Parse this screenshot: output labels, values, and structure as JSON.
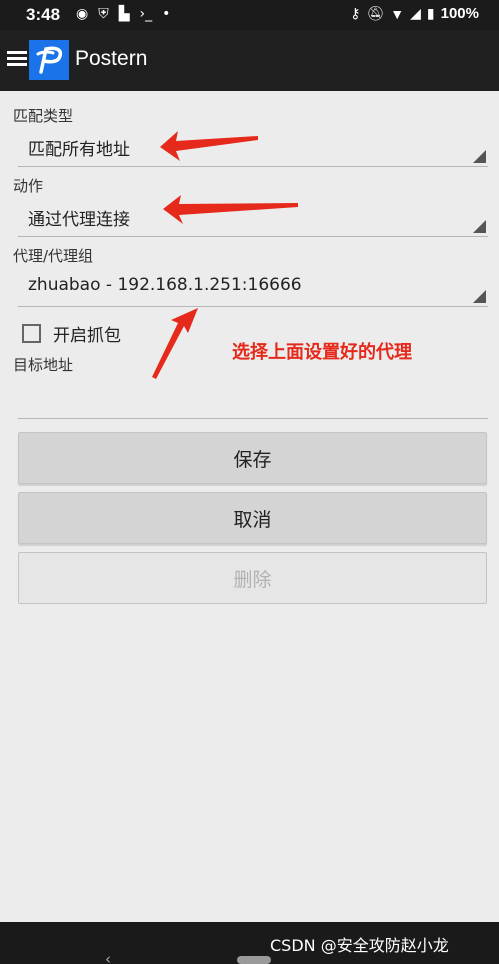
{
  "status_bar": {
    "time": "3:48",
    "left_icons": [
      "media-icon",
      "shield-icon",
      "android-icon",
      "terminal-icon",
      "dot-icon"
    ],
    "battery": "100%"
  },
  "app_bar": {
    "title": "Postern"
  },
  "form": {
    "match_type_label": "匹配类型",
    "match_type_value": "匹配所有地址",
    "action_label": "动作",
    "action_value": "通过代理连接",
    "proxy_label": "代理/代理组",
    "proxy_value": "zhuabao - 192.168.1.251:16666",
    "capture_label": "开启抓包",
    "capture_checked": false,
    "target_label": "目标地址",
    "target_value": ""
  },
  "buttons": {
    "save": "保存",
    "cancel": "取消",
    "delete": "删除"
  },
  "annotation": {
    "text": "选择上面设置好的代理",
    "color": "#e52a1c"
  },
  "footer": {
    "watermark": "CSDN @安全攻防赵小龙"
  },
  "colors": {
    "app_bar": "#202020",
    "logo": "#1a73e8",
    "content_bg": "#ececec"
  }
}
